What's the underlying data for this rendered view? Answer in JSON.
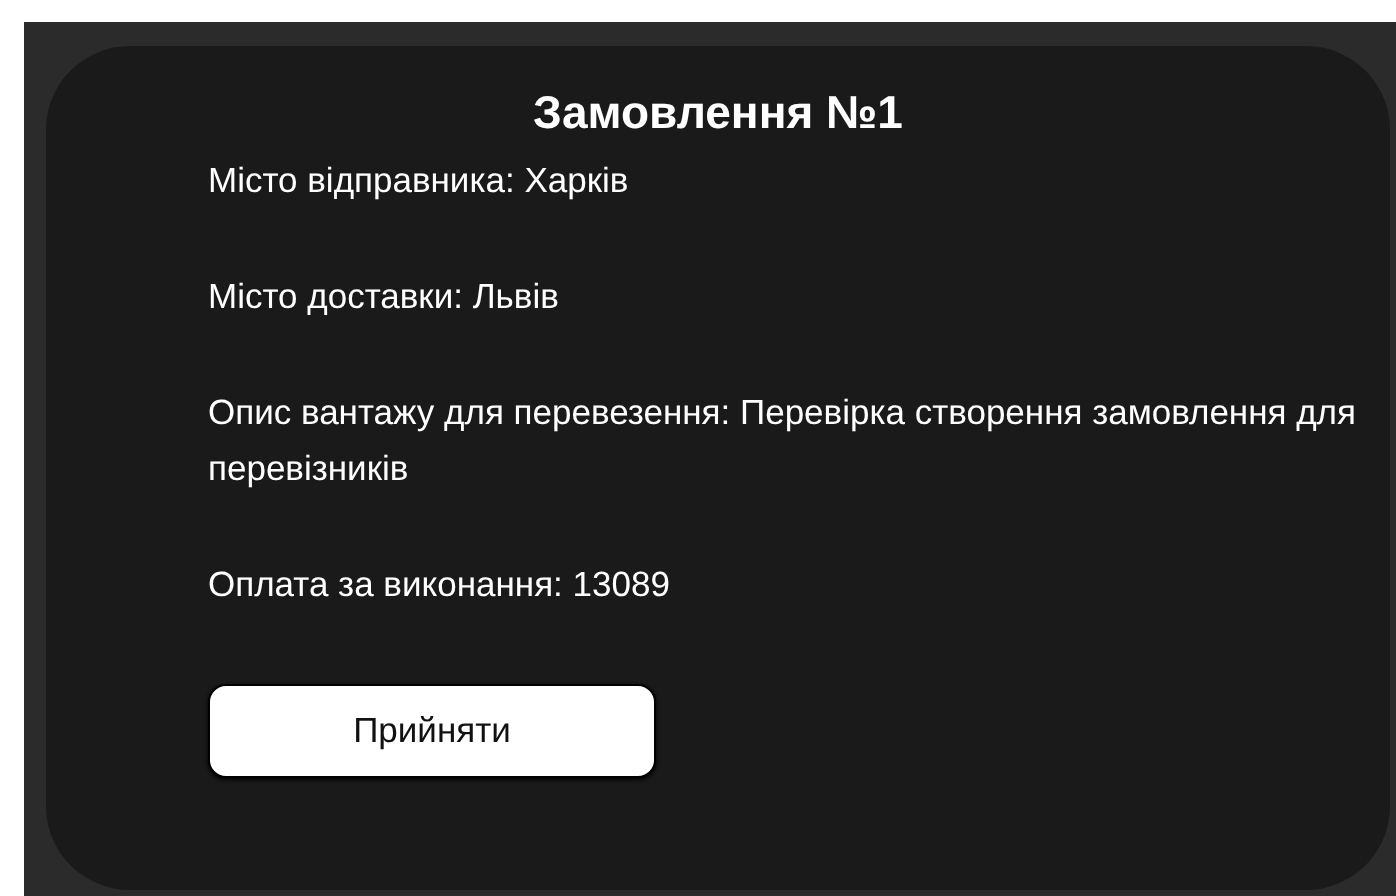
{
  "order": {
    "title": "Замовлення №1",
    "details": [
      "Місто відправника: Харків",
      "Місто доставки: Львів",
      "Опис вантажу для перевезення: Перевірка створення замовлення для перевізників",
      "Оплата за виконання: 13089"
    ],
    "button": "Прийняти"
  }
}
